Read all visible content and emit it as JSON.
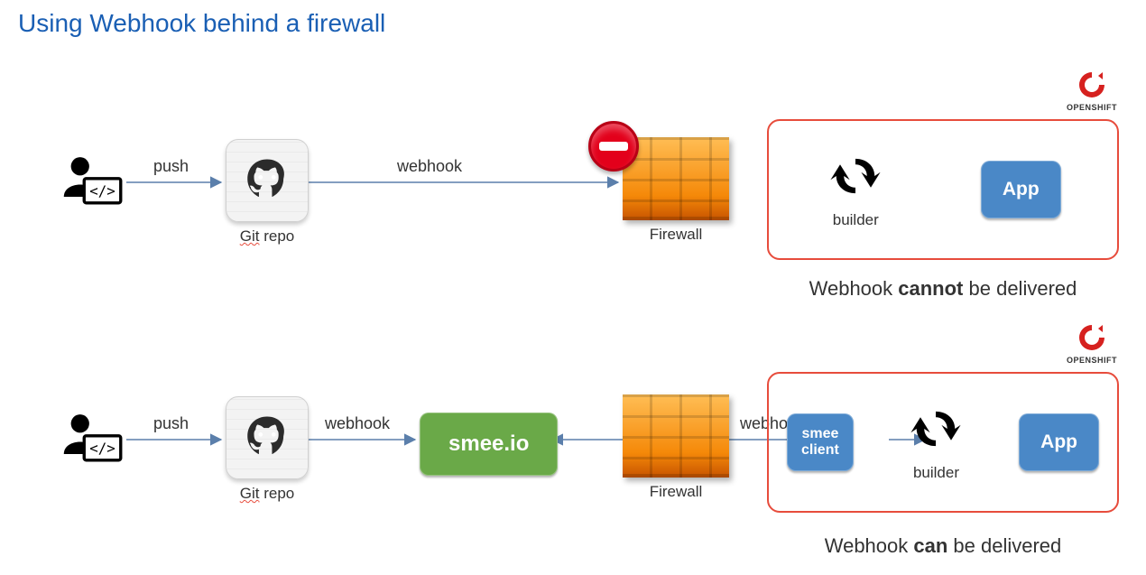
{
  "title": "Using Webhook behind a firewall",
  "openshift_label": "OPENSHIFT",
  "labels": {
    "push": "push",
    "webhook": "webhook",
    "git_repo_prefix": "Git",
    "git_repo_suffix": " repo",
    "firewall": "Firewall",
    "builder": "builder"
  },
  "boxes": {
    "app": "App",
    "smee_service": "smee.io",
    "smee_client_line1": "smee",
    "smee_client_line2": "client"
  },
  "captions": {
    "top_pre": "Webhook ",
    "top_strong": "cannot",
    "top_post": " be delivered",
    "bottom_pre": "Webhook ",
    "bottom_strong": "can",
    "bottom_post": " be delivered"
  }
}
